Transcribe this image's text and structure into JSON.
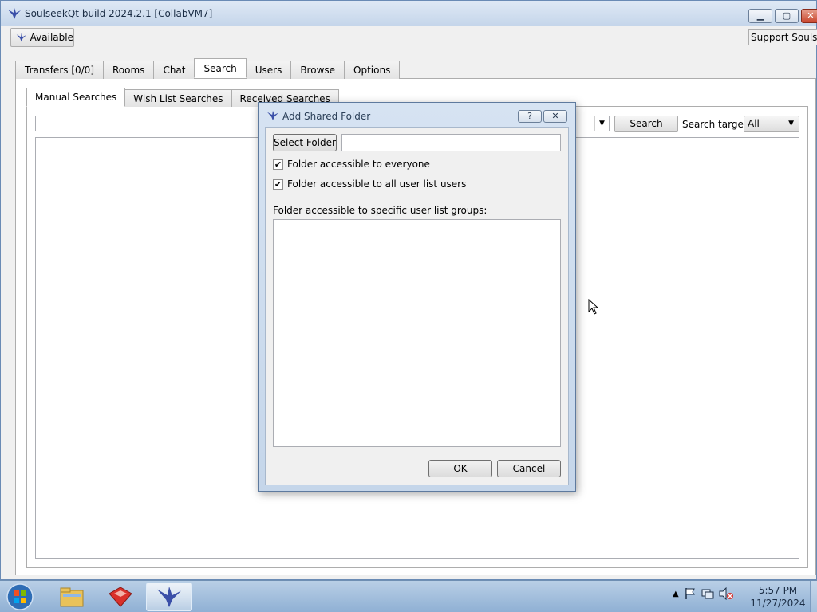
{
  "window": {
    "title": "SoulseekQt build 2024.2.1 [CollabVM7]",
    "status_label": "Available",
    "support_label": "Support Soulseek",
    "minimize": "▁",
    "maximize": "▢",
    "close": "✕"
  },
  "tabs": [
    {
      "label": "Transfers [0/0]"
    },
    {
      "label": "Rooms"
    },
    {
      "label": "Chat"
    },
    {
      "label": "Search",
      "active": true
    },
    {
      "label": "Users"
    },
    {
      "label": "Browse"
    },
    {
      "label": "Options"
    }
  ],
  "search": {
    "subtabs": [
      {
        "label": "Manual Searches",
        "active": true
      },
      {
        "label": "Wish List Searches"
      },
      {
        "label": "Received Searches"
      }
    ],
    "query_value": "",
    "search_button": "Search",
    "target_label": "Search target:",
    "target_value": "All"
  },
  "dialog": {
    "title": "Add Shared Folder",
    "help": "?",
    "close": "✕",
    "select_folder_button": "Select Folder",
    "folder_path_value": "",
    "check_everyone": {
      "label": "Folder accessible to everyone",
      "checked": true
    },
    "check_all_users": {
      "label": "Folder accessible to all user list users",
      "checked": true
    },
    "groups_label": "Folder accessible to specific user list groups:",
    "ok_button": "OK",
    "cancel_button": "Cancel"
  },
  "taskbar": {
    "time": "5:57 PM",
    "date": "11/27/2024"
  },
  "colors": {
    "titlebar": "#c4d5ea",
    "dialog_frame": "#c5d6ea",
    "taskbar": "#8fb0d4"
  }
}
